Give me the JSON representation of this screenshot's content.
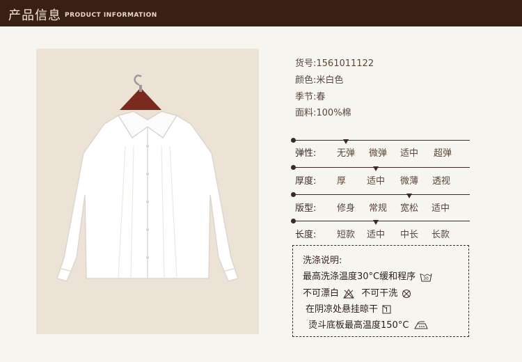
{
  "header": {
    "title_zh": "产品信息",
    "title_en": "PRODUCT INFORMATION"
  },
  "specs": [
    {
      "label": "货号:",
      "value": "1561011122"
    },
    {
      "label": "颜色:",
      "value": "米白色"
    },
    {
      "label": "季节:",
      "value": "春"
    },
    {
      "label": "面料:",
      "value": "100%棉"
    }
  ],
  "scales": [
    {
      "label": "弹性:",
      "options": [
        "无弹",
        "微弹",
        "适中",
        "超弹"
      ],
      "selected_index": 0
    },
    {
      "label": "厚度:",
      "options": [
        "厚",
        "适中",
        "微薄",
        "透视"
      ],
      "selected_index": 1
    },
    {
      "label": "版型:",
      "options": [
        "修身",
        "常规",
        "宽松",
        "适中"
      ],
      "selected_index": 2
    },
    {
      "label": "长度:",
      "options": [
        "短款",
        "适中",
        "中长",
        "长款"
      ],
      "selected_index": 1
    }
  ],
  "wash": {
    "title": "洗涤说明:",
    "line1": "最高洗涤温度30°C缓和程序",
    "line1_icon_text": "30",
    "line2a": "不可漂白",
    "line2b": "不可干洗",
    "line3": "在阴凉处悬挂晾干",
    "line4": "烫斗底板最高温度150°C"
  }
}
